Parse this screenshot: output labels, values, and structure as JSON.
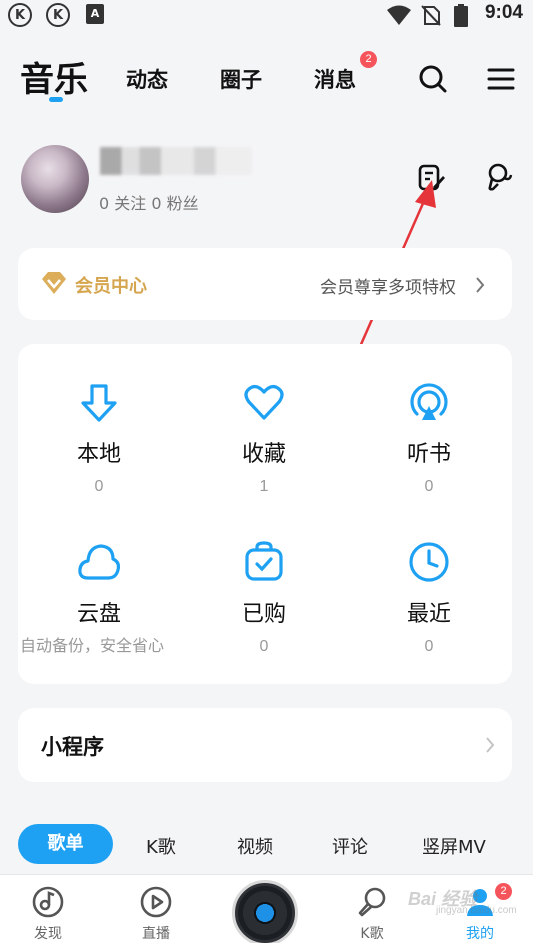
{
  "status_bar": {
    "time": "9:04",
    "notif_k": "K",
    "notif_a": "A"
  },
  "top_nav": {
    "active_tab": "音乐",
    "tabs": [
      "动态",
      "圈子",
      "消息"
    ],
    "message_badge": "2"
  },
  "profile": {
    "follow_text": "0 关注   0 粉丝"
  },
  "vip": {
    "label": "会员中心",
    "promo": "会员尊享多项特权"
  },
  "grid": [
    {
      "label": "本地",
      "count": "0",
      "icon": "download-icon"
    },
    {
      "label": "收藏",
      "count": "1",
      "icon": "heart-icon"
    },
    {
      "label": "听书",
      "count": "0",
      "icon": "audiobook-icon"
    },
    {
      "label": "云盘",
      "hint": "自动备份，安全省心",
      "icon": "cloud-icon"
    },
    {
      "label": "已购",
      "count": "0",
      "icon": "purchased-bag-icon"
    },
    {
      "label": "最近",
      "count": "0",
      "icon": "clock-icon"
    }
  ],
  "mini_program": {
    "label": "小程序"
  },
  "content_tabs": [
    "歌单",
    "K歌",
    "视频",
    "评论",
    "竖屏MV"
  ],
  "bottom_nav": {
    "items": [
      "发现",
      "直播",
      "K歌",
      "我的"
    ],
    "me_badge": "2"
  },
  "watermark": {
    "brand": "Bai 经验",
    "domain": "jingyan.baidu.com"
  },
  "colors": {
    "accent": "#1ea1f3",
    "vip_gold": "#d5a54f",
    "badge_red": "#f5545b"
  }
}
